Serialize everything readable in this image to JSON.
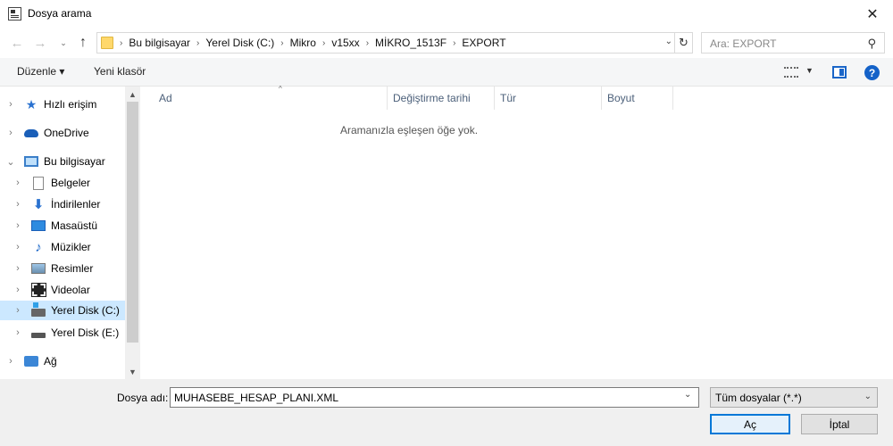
{
  "window": {
    "title": "Dosya arama",
    "close_glyph": "✕"
  },
  "navigation": {
    "back_glyph": "←",
    "forward_glyph": "→",
    "recent_glyph": "⌄",
    "up_glyph": "↑",
    "breadcrumb": [
      "Bu bilgisayar",
      "Yerel Disk (C:)",
      "Mikro",
      "v15xx",
      "MİKRO_1513F",
      "EXPORT"
    ],
    "crumb_separator": "›",
    "refresh_glyph": "↻",
    "dropdown_glyph": "⌄",
    "search_placeholder": "Ara: EXPORT",
    "search_glyph": "⚲"
  },
  "toolbar": {
    "organize_label": "Düzenle ▾",
    "new_folder_label": "Yeni klasör",
    "view_drop_glyph": "▼",
    "help_glyph": "?"
  },
  "sidebar": {
    "items": [
      {
        "label": "Hızlı erişim",
        "icon": "star-icon",
        "glyph": "★",
        "chevron": "›"
      },
      {
        "label": "OneDrive",
        "icon": "cloud-icon",
        "glyph": "",
        "chevron": "›"
      },
      {
        "label": "Bu bilgisayar",
        "icon": "computer-icon",
        "glyph": "",
        "chevron": "⌄"
      },
      {
        "label": "Belgeler",
        "icon": "document-icon",
        "glyph": "",
        "chevron": "›"
      },
      {
        "label": "İndirilenler",
        "icon": "download-icon",
        "glyph": "⬇",
        "chevron": "›"
      },
      {
        "label": "Masaüstü",
        "icon": "desktop-icon",
        "glyph": "",
        "chevron": "›"
      },
      {
        "label": "Müzikler",
        "icon": "music-icon",
        "glyph": "♪",
        "chevron": "›"
      },
      {
        "label": "Resimler",
        "icon": "pictures-icon",
        "glyph": "",
        "chevron": "›"
      },
      {
        "label": "Videolar",
        "icon": "video-icon",
        "glyph": "",
        "chevron": "›"
      },
      {
        "label": "Yerel Disk (C:)",
        "icon": "system-drive-icon",
        "glyph": "",
        "chevron": "›",
        "selected": true
      },
      {
        "label": "Yerel Disk (E:)",
        "icon": "drive-icon",
        "glyph": "",
        "chevron": "›"
      },
      {
        "label": "Ağ",
        "icon": "network-icon",
        "glyph": "",
        "chevron": "›"
      }
    ],
    "scroll_up_glyph": "▲",
    "scroll_down_glyph": "▼"
  },
  "file_list": {
    "columns": [
      "Ad",
      "Değiştirme tarihi",
      "Tür",
      "Boyut"
    ],
    "sort_glyph": "^",
    "empty_message": "Aramanızla eşleşen öğe yok."
  },
  "footer": {
    "filename_label": "Dosya adı:",
    "filename_value": "MUHASEBE_HESAP_PLANI.XML",
    "filetype_value": "Tüm dosyalar (*.*)",
    "dropdown_glyph": "⌄",
    "open_label": "Aç",
    "cancel_label": "İptal"
  },
  "colors": {
    "accent": "#0078d7",
    "selection": "#cce8ff",
    "header_text": "#4c607a"
  }
}
